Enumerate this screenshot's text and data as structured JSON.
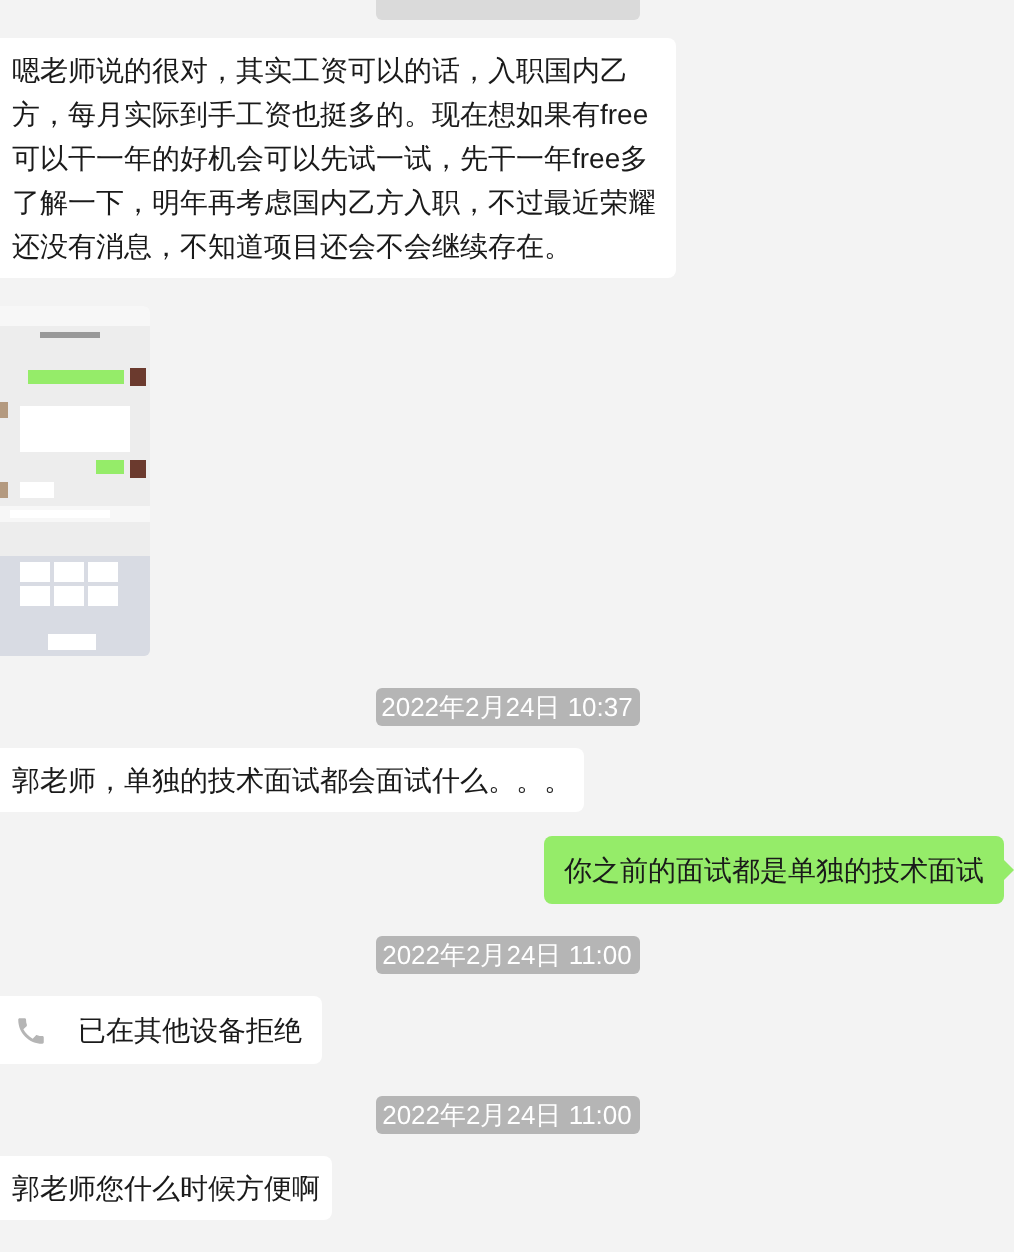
{
  "messages": [
    {
      "kind": "cut_timestamp"
    },
    {
      "kind": "received_text",
      "text": "嗯老师说的很对，其实工资可以的话，入职国内乙方，每月实际到手工资也挺多的。现在想如果有free可以干一年的好机会可以先试一试，先干一年free多了解一下，明年再考虑国内乙方入职，不过最近荣耀还没有消息，不知道项目还会不会继续存在。"
    },
    {
      "kind": "screenshot"
    },
    {
      "kind": "timestamp",
      "text": "2022年2月24日 10:37"
    },
    {
      "kind": "received_text",
      "text": "郭老师，单独的技术面试都会面试什么。。。"
    },
    {
      "kind": "sent_text",
      "text": "你之前的面试都是单独的技术面试"
    },
    {
      "kind": "timestamp",
      "text": "2022年2月24日 11:00"
    },
    {
      "kind": "call",
      "text": "已在其他设备拒绝"
    },
    {
      "kind": "timestamp",
      "text": "2022年2月24日 11:00"
    },
    {
      "kind": "received_text",
      "text": "郭老师您什么时候方便啊"
    }
  ]
}
